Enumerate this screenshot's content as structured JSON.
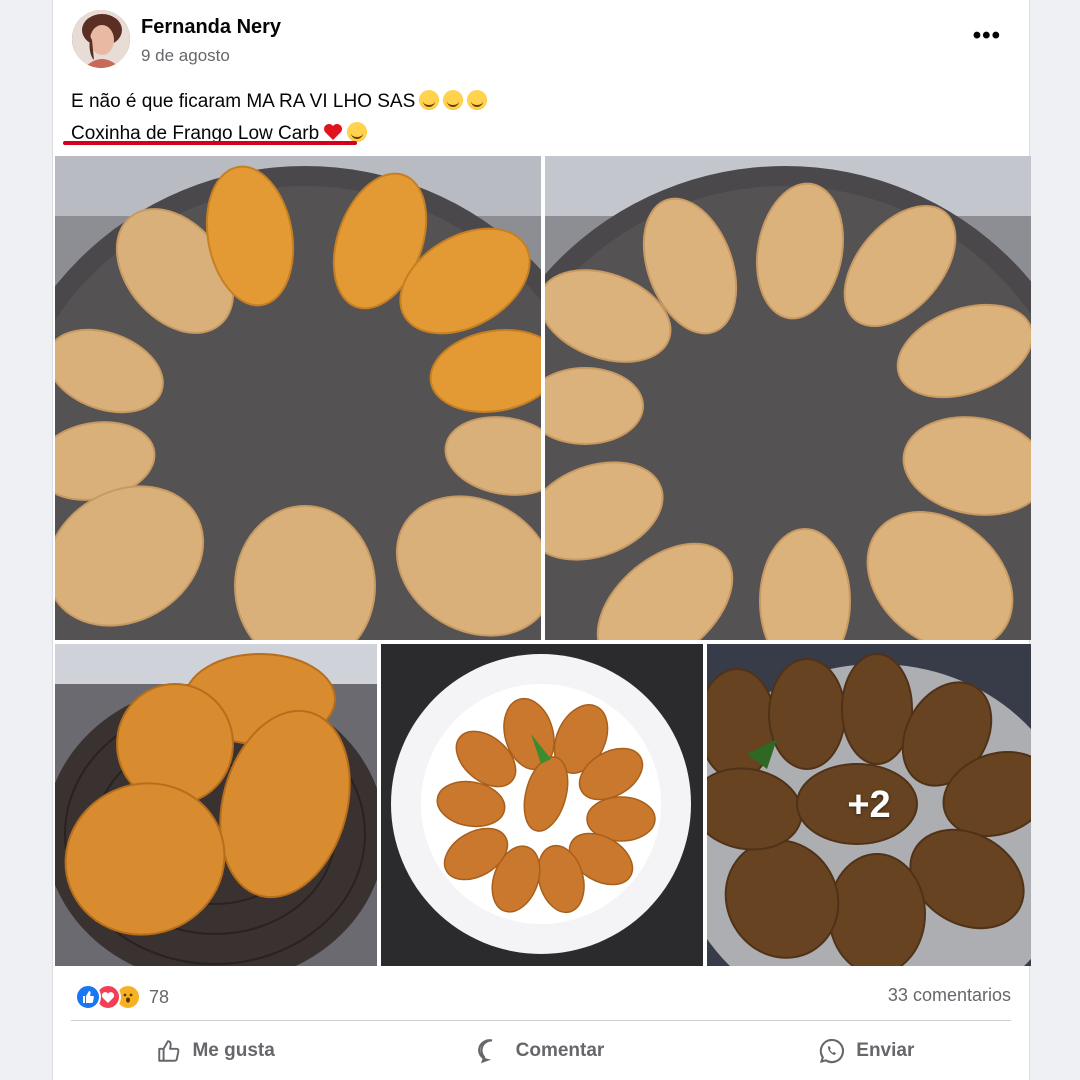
{
  "post": {
    "author": "Fernanda Nery",
    "date": "9 de agosto",
    "text_line1": "E não é que ficaram MA RA VI LHO SAS",
    "text_line2": "Coxinha de Frango Low Carb",
    "line1_emojis": [
      "smiling-face-icon",
      "smiling-face-icon",
      "smiling-face-icon"
    ],
    "line2_emojis": [
      "red-heart-icon",
      "teary-face-icon"
    ],
    "more_options_icon": "more-options-icon"
  },
  "photos": {
    "extra_count_label": "+2"
  },
  "stats": {
    "reaction_icons": [
      "like-icon",
      "love-icon",
      "wow-icon"
    ],
    "reaction_count": "78",
    "comments_label": "33 comentarios"
  },
  "actions": {
    "like_label": "Me gusta",
    "comment_label": "Comentar",
    "share_label": "Enviar"
  },
  "colors": {
    "like_blue": "#1877f2",
    "love_red": "#f33e58",
    "wow_yellow": "#f7b125",
    "underline_red": "#d0021b"
  }
}
